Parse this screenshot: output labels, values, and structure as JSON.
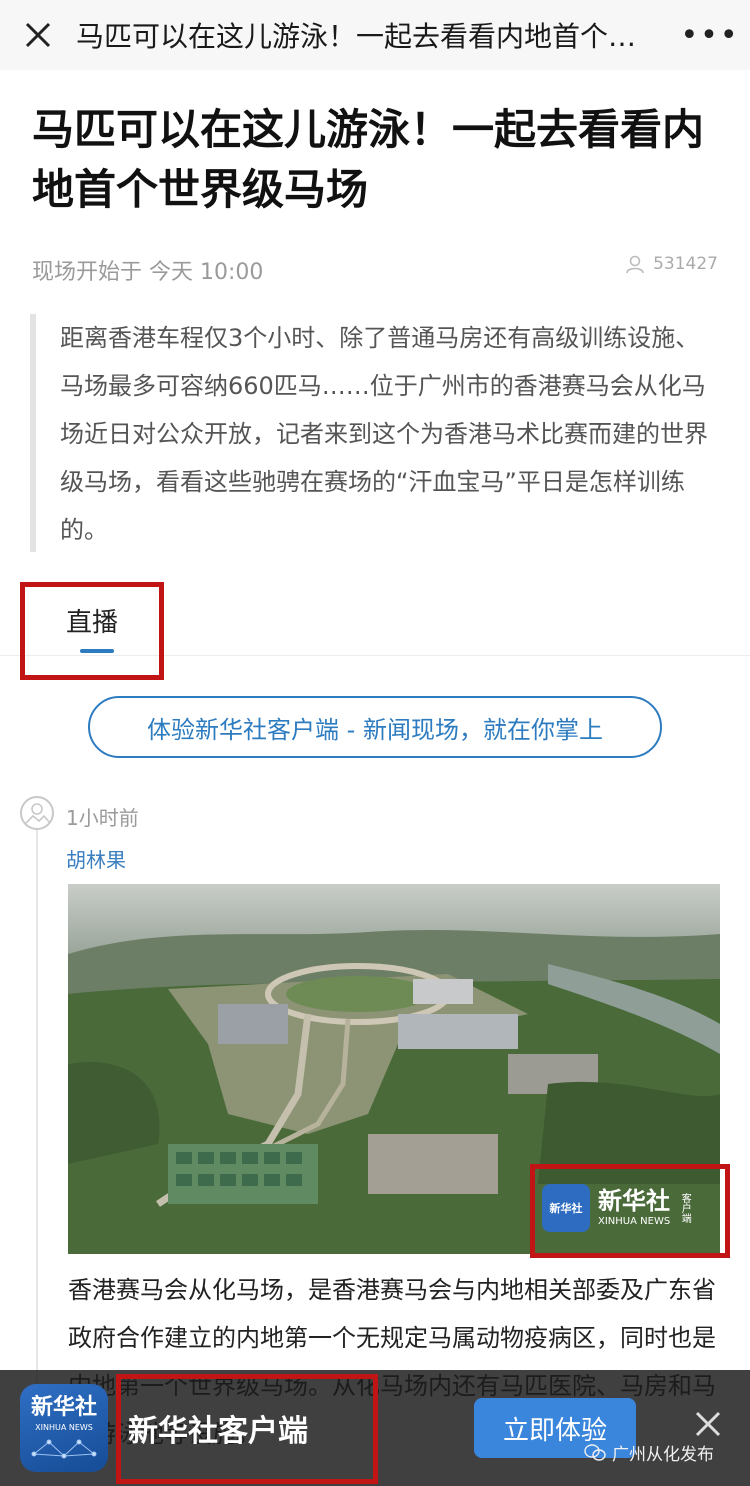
{
  "topbar": {
    "title": "马匹可以在这儿游泳！一起去看看内地首个世界级马场",
    "more_label": "•••"
  },
  "article": {
    "title": "马匹可以在这儿游泳！一起去看看内地首个世界级马场",
    "start_time": "现场开始于 今天 10:00",
    "views": "531427",
    "summary": "距离香港车程仅3个小时、除了普通马房还有高级训练设施、马场最多可容纳660匹马……位于广州市的香港赛马会从化马场近日对公众开放，记者来到这个为香港马术比赛而建的世界级马场，看看这些驰骋在赛场的“汗血宝马”平日是怎样训练的。"
  },
  "tabs": [
    {
      "label": "直播",
      "active": true
    }
  ],
  "app_banner": {
    "label": "体验新华社客户端 - 新闻现场，就在你掌上"
  },
  "post": {
    "time": "1小时前",
    "author": "胡林果",
    "photo_watermark": {
      "cn": "新华社",
      "en": "XINHUA NEWS",
      "side": "客户端"
    },
    "caption": "香港赛马会从化马场，是香港赛马会与内地相关部委及广东省政府合作建立的内地第一个无规定马属动物疫病区，同时也是内地第一个世界级马场。从化马场内还有马匹医院、马房和马匹游泳池等设施。"
  },
  "bottom_bar": {
    "logo_cn": "新华社",
    "logo_en": "XINHUA NEWS",
    "app_name": "新华社客户端",
    "cta_label": "立即体验"
  },
  "watermark": {
    "text": "广州从化发布"
  },
  "colors": {
    "accent": "#2e7cc0",
    "highlight": "#c11515",
    "cta": "#3a86dd"
  }
}
